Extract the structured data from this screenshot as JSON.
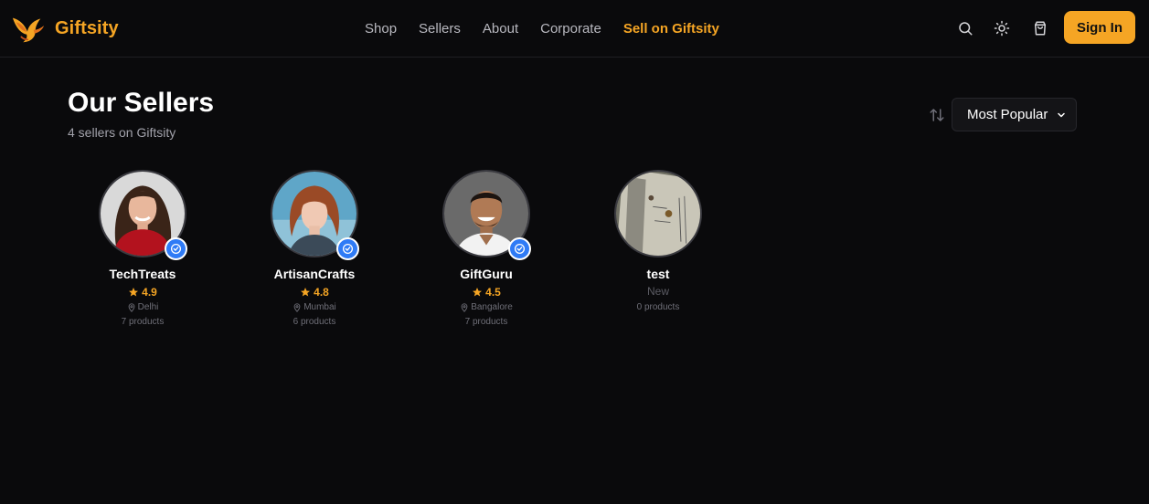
{
  "header": {
    "brand": "Giftsity",
    "nav": [
      "Shop",
      "Sellers",
      "About",
      "Corporate",
      "Sell on Giftsity"
    ],
    "icons": [
      "search-icon",
      "sun-icon",
      "cart-icon"
    ],
    "signin_label": "Sign In"
  },
  "page": {
    "title": "Our Sellers",
    "subtitle": "4 sellers on Giftsity",
    "sort": {
      "selected": "Most Popular",
      "icon": "sort-arrows-icon"
    }
  },
  "sellers": [
    {
      "name": "TechTreats",
      "rating": "4.9",
      "location": "Delhi",
      "products": "7 products",
      "verified": true
    },
    {
      "name": "ArtisanCrafts",
      "rating": "4.8",
      "location": "Mumbai",
      "products": "6 products",
      "verified": true
    },
    {
      "name": "GiftGuru",
      "rating": "4.5",
      "location": "Bangalore",
      "products": "7 products",
      "verified": true
    },
    {
      "name": "test",
      "rating_text": "New",
      "products": "0 products",
      "verified": false
    }
  ],
  "colors": {
    "background": "#0a0a0c",
    "accent": "#f5a524",
    "verified": "#2f7bf6",
    "muted": "#a1a1aa"
  }
}
